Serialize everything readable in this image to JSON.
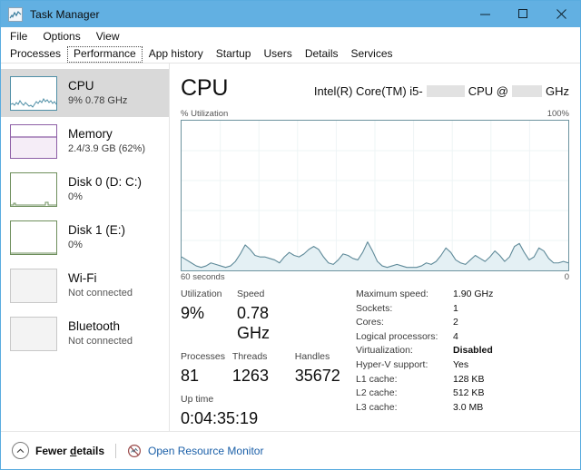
{
  "window": {
    "title": "Task Manager",
    "icon": "task-manager-icon",
    "minimize_glyph": "—",
    "maximize_glyph": "□",
    "close_glyph": "✕",
    "titlebar_color": "#62b0e2"
  },
  "menu": {
    "items": [
      {
        "label": "File"
      },
      {
        "label": "Options"
      },
      {
        "label": "View"
      }
    ]
  },
  "tabs": {
    "selected": "Performance",
    "items": [
      {
        "label": "Processes"
      },
      {
        "label": "Performance"
      },
      {
        "label": "App history"
      },
      {
        "label": "Startup"
      },
      {
        "label": "Users"
      },
      {
        "label": "Details"
      },
      {
        "label": "Services"
      }
    ]
  },
  "sidebar": {
    "items": [
      {
        "name": "CPU",
        "title": "CPU",
        "subtitle": "9%  0.78 GHz",
        "selected": true,
        "thumb_kind": "cpu",
        "accent": "#4f8fa6"
      },
      {
        "name": "Memory",
        "title": "Memory",
        "subtitle": "2.4/3.9 GB (62%)",
        "selected": false,
        "thumb_kind": "mem",
        "accent": "#8d5fa6"
      },
      {
        "name": "Disk 0",
        "title": "Disk 0 (D: C:)",
        "subtitle": "0%",
        "selected": false,
        "thumb_kind": "disk",
        "accent": "#6e8f5c"
      },
      {
        "name": "Disk 1",
        "title": "Disk 1 (E:)",
        "subtitle": "0%",
        "selected": false,
        "thumb_kind": "disk",
        "accent": "#6e8f5c"
      },
      {
        "name": "Wi-Fi",
        "title": "Wi-Fi",
        "subtitle": "Not connected",
        "selected": false,
        "thumb_kind": "plain",
        "accent": "#c8c8c8"
      },
      {
        "name": "Bluetooth",
        "title": "Bluetooth",
        "subtitle": "Not connected",
        "selected": false,
        "thumb_kind": "plain",
        "accent": "#c8c8c8"
      }
    ]
  },
  "main": {
    "heading": "CPU",
    "cpu_model_prefix": "Intel(R) Core(TM) i5-",
    "cpu_model_middle": "CPU @",
    "cpu_model_suffix": "GHz",
    "graph_axis_label": "% Utilization",
    "graph_axis_max": "100%",
    "graph_time_left": "60 seconds",
    "graph_time_right": "0",
    "line_color": "#5f8a99",
    "fill_color": "#e4f0f4",
    "stats_primary": [
      {
        "label": "Utilization",
        "value": "9%"
      },
      {
        "label": "Speed",
        "value": "0.78 GHz"
      }
    ],
    "stats_secondary": [
      {
        "label": "Processes",
        "value": "81"
      },
      {
        "label": "Threads",
        "value": "1263"
      },
      {
        "label": "Handles",
        "value": "35672"
      }
    ],
    "uptime": {
      "label": "Up time",
      "value": "0:04:35:19"
    },
    "details": [
      {
        "key": "Maximum speed:",
        "value": "1.90 GHz",
        "bold": false
      },
      {
        "key": "Sockets:",
        "value": "1",
        "bold": false
      },
      {
        "key": "Cores:",
        "value": "2",
        "bold": false
      },
      {
        "key": "Logical processors:",
        "value": "4",
        "bold": false
      },
      {
        "key": "Virtualization:",
        "value": "Disabled",
        "bold": true
      },
      {
        "key": "Hyper-V support:",
        "value": "Yes",
        "bold": false
      },
      {
        "key": "L1 cache:",
        "value": "128 KB",
        "bold": false
      },
      {
        "key": "L2 cache:",
        "value": "512 KB",
        "bold": false
      },
      {
        "key": "L3 cache:",
        "value": "3.0 MB",
        "bold": false
      }
    ]
  },
  "statusbar": {
    "fewer_details_pre": "Fewer ",
    "fewer_details_accel": "d",
    "fewer_details_post": "etails",
    "resource_monitor": "Open Resource Monitor",
    "link_color": "#1a5fa8"
  },
  "chart_data": {
    "type": "area",
    "title": "% Utilization",
    "xlabel": "60 seconds",
    "ylabel": "% Utilization",
    "ylim": [
      0,
      100
    ],
    "xlim": [
      60,
      0
    ],
    "grid": true,
    "legend": false,
    "series": [
      {
        "name": "CPU utilization",
        "values": [
          9,
          7,
          5,
          3,
          2,
          3,
          5,
          4,
          3,
          2,
          3,
          6,
          11,
          17,
          14,
          10,
          9,
          9,
          8,
          7,
          5,
          9,
          12,
          10,
          9,
          11,
          14,
          16,
          14,
          9,
          5,
          4,
          7,
          11,
          10,
          8,
          7,
          12,
          19,
          13,
          6,
          3,
          2,
          3,
          4,
          3,
          2,
          2,
          2,
          3,
          5,
          4,
          6,
          10,
          15,
          12,
          7,
          5,
          4,
          7,
          10,
          8,
          6,
          9,
          13,
          10,
          6,
          9,
          16,
          18,
          12,
          7,
          9,
          15,
          13,
          8,
          5,
          5,
          6,
          5
        ]
      }
    ]
  }
}
